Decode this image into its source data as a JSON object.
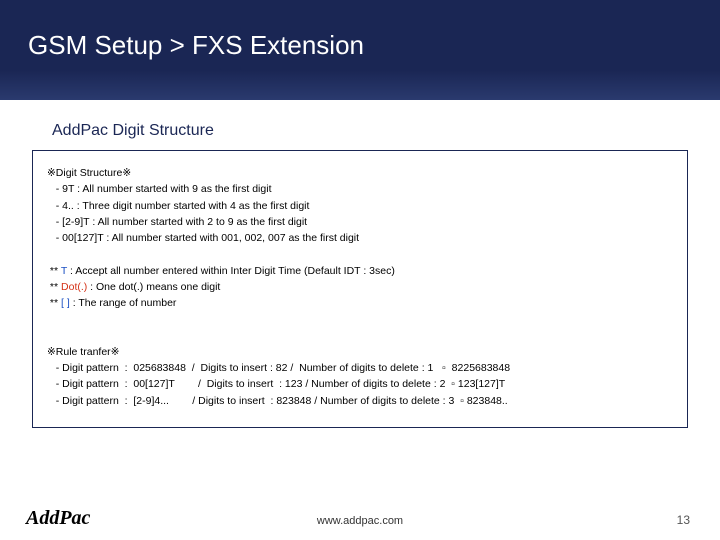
{
  "header": {
    "title": "GSM Setup > FXS Extension"
  },
  "subtitle": "AddPac Digit Structure",
  "box": {
    "sec1_header": "※Digit Structure※",
    "sec1_l1": "   - 9T : All number started with 9 as the first digit",
    "sec1_l2": "   - 4.. : Three digit number started with 4 as the first digit",
    "sec1_l3": "   - [2-9]T : All number started with 2 to 9 as the first digit",
    "sec1_l4": "   - 00[127]T : All number started with 001, 002, 007 as the first digit",
    "sec2_pre": " ** ",
    "sec2_T": "T",
    "sec2_post": " : Accept all number entered within Inter Digit Time (Default IDT : 3sec)",
    "sec3_pre": " ** ",
    "sec3_Dot": "Dot(.)",
    "sec3_post": " : One dot(.) means one digit",
    "sec4_pre": " ** ",
    "sec4_br": "[ ]",
    "sec4_post": " : The range of number",
    "sec5_header": "※Rule tranfer※",
    "sec5_l1": "   - Digit pattern  :  025683848  /  Digits to insert : 82 /  Number of digits to delete : 1   ▫  8225683848",
    "sec5_l2": "   - Digit pattern  :  00[127]T        /  Digits to insert  : 123 / Number of digits to delete : 2  ▫ 123[127]T",
    "sec5_l3": "   - Digit pattern  :  [2-9]4...        / Digits to insert  : 823848 / Number of digits to delete : 3  ▫ 823848.."
  },
  "footer": {
    "logo": "AddPac",
    "url": "www.addpac.com",
    "page": "13"
  }
}
